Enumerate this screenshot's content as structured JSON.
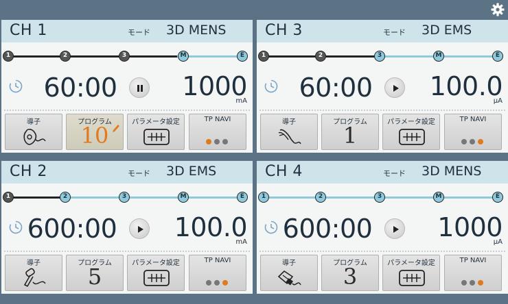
{
  "settings": {
    "icon": "gear-icon"
  },
  "colors": {
    "header": "#cfe4ea",
    "accent_blue": "#8ec9de",
    "accent_orange": "#e07a1f"
  },
  "labels": {
    "mode": "モード",
    "electrode": "導子",
    "program": "プログラム",
    "parameter": "パラメータ設定",
    "tpnavi": "TP NAVI"
  },
  "channels": [
    {
      "name": "CH 1",
      "mode": "3D MENS",
      "steps": [
        {
          "label": "1",
          "state": "done"
        },
        {
          "label": "2",
          "state": "done"
        },
        {
          "label": "3",
          "state": "done"
        },
        {
          "label": "M",
          "state": "todo"
        },
        {
          "label": "E",
          "state": "todo"
        }
      ],
      "progress": 0.72,
      "time": "60:00",
      "control": "pause",
      "intensity": "1000",
      "unit": "mA",
      "program": "10",
      "program_editing": true,
      "electrode_icon": "pad-electrode-icon",
      "tpnavi_active_index": 0
    },
    {
      "name": "CH 2",
      "mode": "3D EMS",
      "steps": [
        {
          "label": "1",
          "state": "done"
        },
        {
          "label": "2",
          "state": "todo"
        },
        {
          "label": "3",
          "state": "todo"
        },
        {
          "label": "M",
          "state": "todo"
        },
        {
          "label": "E",
          "state": "todo"
        }
      ],
      "progress": 0.25,
      "time": "600:00",
      "control": "play",
      "intensity": "100.0",
      "unit": "mA",
      "program": "5",
      "program_editing": false,
      "electrode_icon": "probe-electrode-icon",
      "tpnavi_active_index": 2
    },
    {
      "name": "CH 3",
      "mode": "3D EMS",
      "steps": [
        {
          "label": "1",
          "state": "done"
        },
        {
          "label": "2",
          "state": "done"
        },
        {
          "label": "3",
          "state": "todo"
        },
        {
          "label": "M",
          "state": "todo"
        },
        {
          "label": "E",
          "state": "todo"
        }
      ],
      "progress": 0.48,
      "time": "60:00",
      "control": "play",
      "intensity": "100.0",
      "unit": "μA",
      "program": "1",
      "program_editing": false,
      "electrode_icon": "roller-electrode-icon",
      "tpnavi_active_index": 2
    },
    {
      "name": "CH 4",
      "mode": "3D MENS",
      "steps": [
        {
          "label": "1",
          "state": "todo"
        },
        {
          "label": "2",
          "state": "todo"
        },
        {
          "label": "3",
          "state": "todo"
        },
        {
          "label": "M",
          "state": "todo"
        },
        {
          "label": "E",
          "state": "todo"
        }
      ],
      "progress": 0,
      "time": "600:00",
      "control": "play",
      "intensity": "1000",
      "unit": "μA",
      "program": "3",
      "program_editing": false,
      "electrode_icon": "glove-electrode-icon",
      "tpnavi_active_index": 2
    }
  ]
}
